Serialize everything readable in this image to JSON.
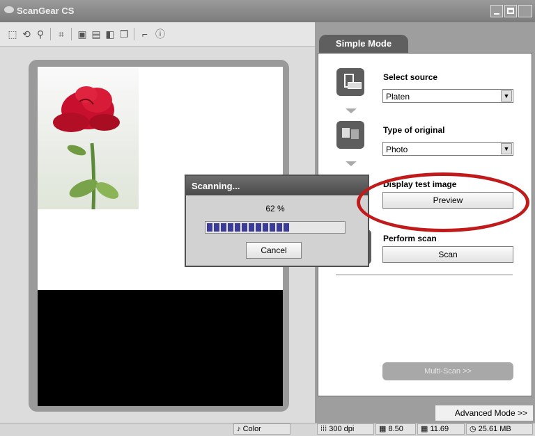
{
  "window": {
    "title": "ScanGear CS"
  },
  "tab": {
    "label": "Simple Mode"
  },
  "steps": {
    "source": {
      "label": "Select source",
      "value": "Platen"
    },
    "original": {
      "label": "Type of original",
      "value": "Photo"
    },
    "preview": {
      "label": "Display test image",
      "button": "Preview"
    },
    "scan": {
      "label": "Perform scan",
      "button": "Scan"
    }
  },
  "multiscan": {
    "label": "Multi-Scan >>"
  },
  "advanced": {
    "label": "Advanced Mode >>"
  },
  "dialog": {
    "title": "Scanning...",
    "percent_text": "62 %",
    "progress": 0.62,
    "cancel": "Cancel"
  },
  "status": {
    "color_mode": "Color",
    "resolution": "300 dpi",
    "width": "8.50",
    "height": "11.69",
    "size": "25.61 MB"
  },
  "icons": [
    "marquee-icon",
    "rotate-icon",
    "zoom-icon",
    "crop-icon",
    "thumbnail-icon",
    "auto-crop-icon",
    "color-icon",
    "copy-icon",
    "mirror-icon",
    "info-icon"
  ]
}
